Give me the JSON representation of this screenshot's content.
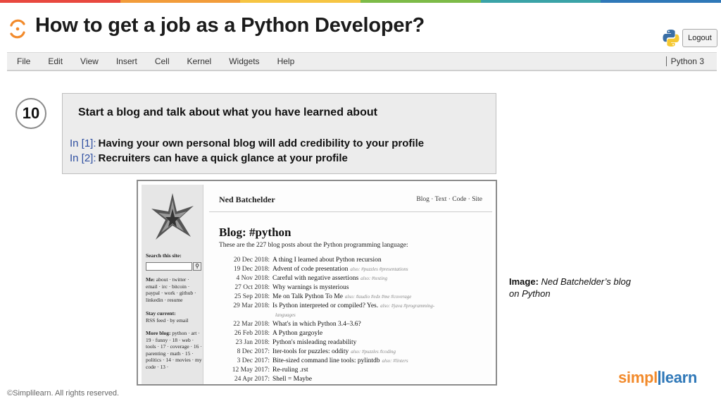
{
  "slide": {
    "title": "How to get a job as a Python Developer?",
    "step_number": "10",
    "copyright": "©Simplilearn. All rights reserved.",
    "brand": {
      "part1": "simpl",
      "part2": "learn"
    },
    "top_stripe_colors": [
      "#e8483f",
      "#f29c3b",
      "#f6c543",
      "#7dbb48",
      "#3aa3a7",
      "#2f78b8"
    ]
  },
  "notebook": {
    "logout_label": "Logout",
    "menu": [
      "File",
      "Edit",
      "View",
      "Insert",
      "Cell",
      "Kernel",
      "Widgets",
      "Help"
    ],
    "kernel": "Python 3"
  },
  "cell": {
    "heading": "Start a blog and talk about what you have learned about",
    "rows": [
      {
        "prompt": "In [1]:",
        "text": "Having your own personal blog will add credibility to your profile"
      },
      {
        "prompt": "In [2]:",
        "text": "Recruiters can have a quick glance at your profile"
      }
    ]
  },
  "blog": {
    "author": "Ned Batchelder",
    "nav": "Blog · Text · Code · Site",
    "page_title": "Blog: #python",
    "description": "These are the 227 blog posts about the Python programming language:",
    "sidebar": {
      "search_label": "Search this site:",
      "me_label": "Me:",
      "me_text": " about · twitter · email · irc · bitcoin · paypal · work · github · linkedin · resume",
      "stay_label": "Stay current:",
      "stay_text": "RSS feed · by email",
      "more_label": "More blog:",
      "more_text": " python · art · 19 · funny · 18 · web · tools · 17 · coverage · 16 · parenting · math · 15 · politics · 14 · movies · my code · 13 ·"
    },
    "posts": [
      {
        "date": "20 Dec 2018:",
        "title": "A thing I learned about Python recursion",
        "tags": ""
      },
      {
        "date": "19 Dec 2018:",
        "title": "Advent of code presentation",
        "tags": "also: #puzzles #presentations"
      },
      {
        "date": "4 Nov 2018:",
        "title": "Careful with negative assertions",
        "tags": "also: #testing"
      },
      {
        "date": "27 Oct 2018:",
        "title": "Why warnings is mysterious",
        "tags": ""
      },
      {
        "date": "25 Sep 2018:",
        "title": "Me on Talk Python To Me",
        "tags": "also: #audio #edx #me #coverage"
      },
      {
        "date": "29 Mar 2018:",
        "title": "Is Python interpreted or compiled? Yes.",
        "tags": "also: #java #programming-"
      },
      {
        "date": "22 Mar 2018:",
        "title": "What's in which Python 3.4–3.6?",
        "tags": ""
      },
      {
        "date": "26 Feb 2018:",
        "title": "A Python gargoyle",
        "tags": ""
      },
      {
        "date": "23 Jan 2018:",
        "title": "Python's misleading readability",
        "tags": ""
      },
      {
        "date": "8 Dec 2017:",
        "title": "Iter-tools for puzzles: oddity",
        "tags": "also: #puzzles #coding"
      },
      {
        "date": "3 Dec 2017:",
        "title": "Bite-sized command line tools: pylintdb",
        "tags": "also: #linters"
      },
      {
        "date": "12 May 2017:",
        "title": "Re-ruling .rst",
        "tags": ""
      },
      {
        "date": "24 Apr 2017:",
        "title": "Shell = Maybe",
        "tags": ""
      }
    ],
    "tag_continuation": "languages"
  },
  "caption": {
    "label": "Image:",
    "text_line1": "Ned Batchelder’s blog",
    "text_line2": "on Python"
  }
}
